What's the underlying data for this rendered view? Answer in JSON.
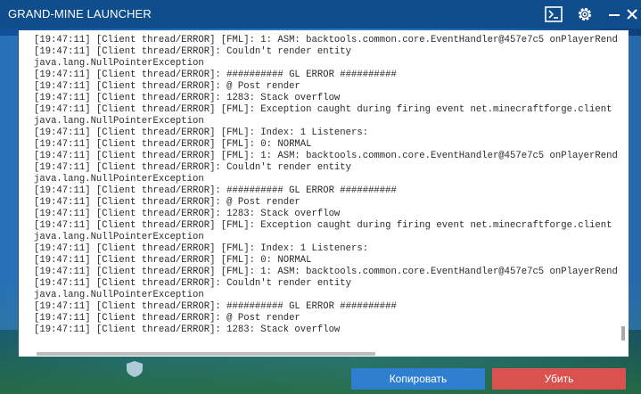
{
  "window": {
    "title": "GRAND-MINE LAUNCHER"
  },
  "icons": {
    "console": "terminal-icon",
    "settings": "gear-icon",
    "minimize": "minimize-icon",
    "close": "close-icon"
  },
  "log": {
    "lines": [
      "[19:47:11] [Client thread/ERROR] [FML]: 1: ASM: backtools.common.core.EventHandler@457e7c5 onPlayerRend",
      "[19:47:11] [Client thread/ERROR]: Couldn't render entity",
      "java.lang.NullPointerException",
      "[19:47:11] [Client thread/ERROR]: ########## GL ERROR ##########",
      "[19:47:11] [Client thread/ERROR]: @ Post render",
      "[19:47:11] [Client thread/ERROR]: 1283: Stack overflow",
      "[19:47:11] [Client thread/ERROR] [FML]: Exception caught during firing event net.minecraftforge.client",
      "java.lang.NullPointerException",
      "[19:47:11] [Client thread/ERROR] [FML]: Index: 1 Listeners:",
      "[19:47:11] [Client thread/ERROR] [FML]: 0: NORMAL",
      "[19:47:11] [Client thread/ERROR] [FML]: 1: ASM: backtools.common.core.EventHandler@457e7c5 onPlayerRend",
      "[19:47:11] [Client thread/ERROR]: Couldn't render entity",
      "java.lang.NullPointerException",
      "[19:47:11] [Client thread/ERROR]: ########## GL ERROR ##########",
      "[19:47:11] [Client thread/ERROR]: @ Post render",
      "[19:47:11] [Client thread/ERROR]: 1283: Stack overflow",
      "[19:47:11] [Client thread/ERROR] [FML]: Exception caught during firing event net.minecraftforge.client",
      "java.lang.NullPointerException",
      "[19:47:11] [Client thread/ERROR] [FML]: Index: 1 Listeners:",
      "[19:47:11] [Client thread/ERROR] [FML]: 0: NORMAL",
      "[19:47:11] [Client thread/ERROR] [FML]: 1: ASM: backtools.common.core.EventHandler@457e7c5 onPlayerRend",
      "[19:47:11] [Client thread/ERROR]: Couldn't render entity",
      "java.lang.NullPointerException",
      "[19:47:11] [Client thread/ERROR]: ########## GL ERROR ##########",
      "[19:47:11] [Client thread/ERROR]: @ Post render",
      "[19:47:11] [Client thread/ERROR]: 1283: Stack overflow"
    ]
  },
  "buttons": {
    "copy": "Копировать",
    "kill": "Убить"
  },
  "colors": {
    "titlebar": "#0f4d8c",
    "copy_button": "#2f7fd0",
    "kill_button": "#d9524f"
  }
}
